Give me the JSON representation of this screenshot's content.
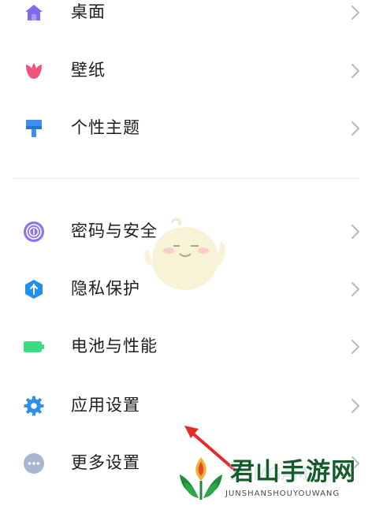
{
  "settings": {
    "items": [
      {
        "label": "桌面",
        "icon": "home-icon",
        "color": "#7b6cf0"
      },
      {
        "label": "壁纸",
        "icon": "tulip-icon",
        "color": "#f0547a"
      },
      {
        "label": "个性主题",
        "icon": "brush-icon",
        "color": "#3d8ef5"
      },
      {
        "label": "密码与安全",
        "icon": "fingerprint-icon",
        "color": "#8a74f2"
      },
      {
        "label": "隐私保护",
        "icon": "privacy-shield-icon",
        "color": "#1f8ff0"
      },
      {
        "label": "电池与性能",
        "icon": "battery-icon",
        "color": "#3ddc84"
      },
      {
        "label": "应用设置",
        "icon": "gear-icon",
        "color": "#2e8ff0"
      },
      {
        "label": "更多设置",
        "icon": "more-dots-icon",
        "color": "#a9b6d0"
      }
    ]
  },
  "watermark": {
    "title": "君山手游网",
    "subtitle": "JUNSHANSHOUYOUWANG",
    "faint_text": "3DMGAME"
  },
  "colors": {
    "text": "#1c1c1c",
    "chevron": "#b8b8b8",
    "arrow": "#e52b2b",
    "watermark_green": "#145c2a"
  }
}
